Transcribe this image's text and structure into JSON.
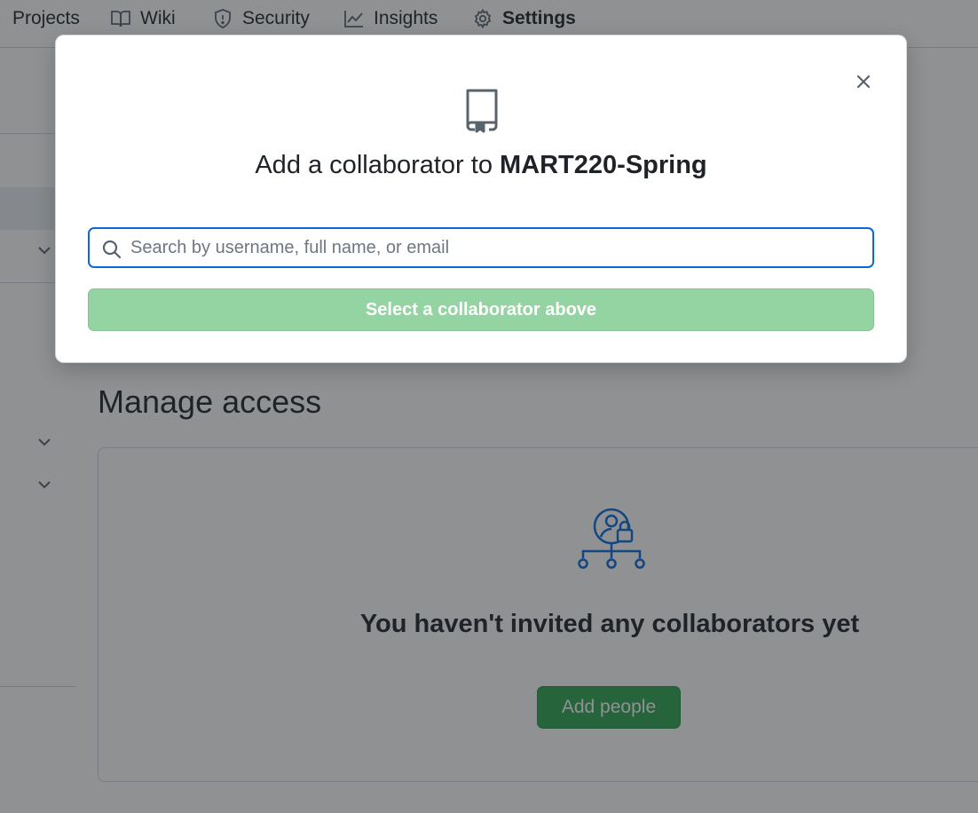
{
  "nav": {
    "items": [
      {
        "label": "Projects",
        "icon": "project-table-icon"
      },
      {
        "label": "Wiki",
        "icon": "book-icon"
      },
      {
        "label": "Security",
        "icon": "shield-icon"
      },
      {
        "label": "Insights",
        "icon": "graph-icon"
      },
      {
        "label": "Settings",
        "icon": "gear-icon",
        "active": true
      }
    ]
  },
  "main": {
    "manage_title": "Manage access",
    "empty_state_title": "You haven't invited any collaborators yet",
    "add_people_label": "Add people"
  },
  "modal": {
    "title_prefix": "Add a collaborator to ",
    "repo_name": "MART220-Spring",
    "search_placeholder": "Search by username, full name, or email",
    "search_value": "",
    "submit_label": "Select a collaborator above",
    "icon": "repo-icon",
    "close_icon": "close-icon"
  },
  "colors": {
    "accent_blue": "#0969da",
    "primary_green": "#2da44e",
    "disabled_green": "#94d3a2",
    "overlay": "rgba(31,35,40,0.5)"
  }
}
